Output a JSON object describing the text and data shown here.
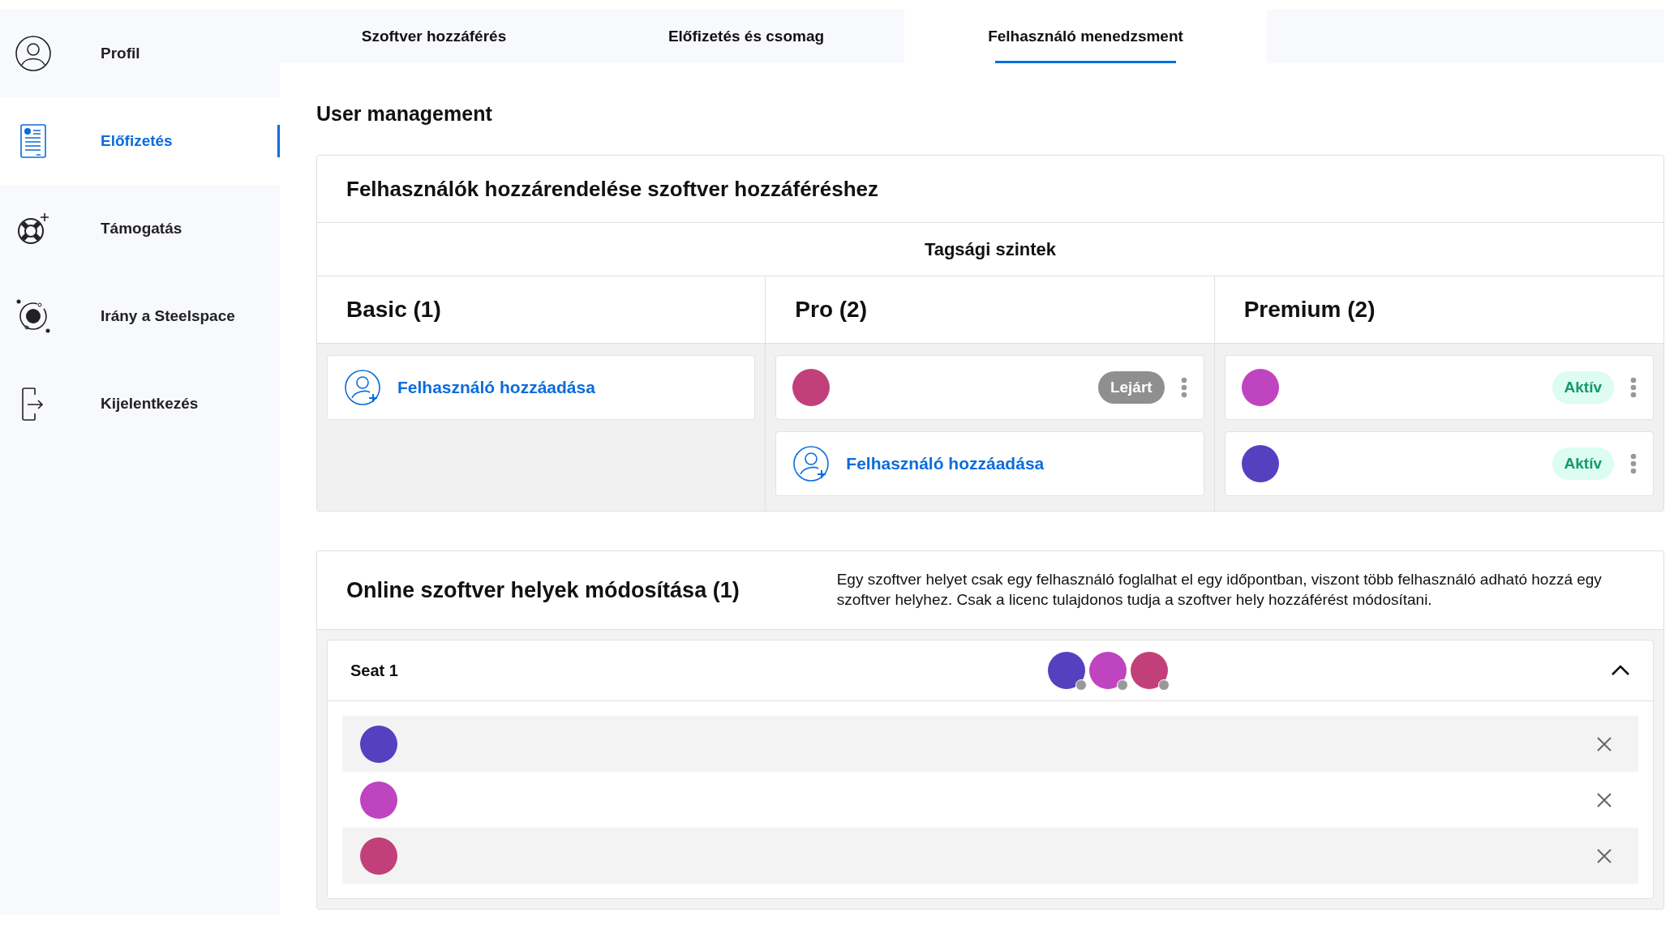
{
  "sidebar": {
    "items": [
      {
        "label": "Profil",
        "kind": "user",
        "selected": false
      },
      {
        "label": "Előfizetés",
        "kind": "document",
        "selected": true
      },
      {
        "label": "Támogatás",
        "kind": "lifebuoy",
        "selected": false
      },
      {
        "label": "Irány a Steelspace",
        "kind": "orbit",
        "selected": false
      },
      {
        "label": "Kijelentkezés",
        "kind": "logout",
        "selected": false
      }
    ]
  },
  "tabs": [
    {
      "label": "Szoftver hozzáférés",
      "selected": false
    },
    {
      "label": "Előfizetés és csomag",
      "selected": false
    },
    {
      "label": "Felhasználó menedzsment",
      "selected": true
    }
  ],
  "page_title": "User management",
  "assignment_card": {
    "title": "Felhasználók hozzárendelése szoftver hozzáféréshez",
    "levels_title": "Tagsági szintek",
    "levels": [
      {
        "title": "Basic (1)",
        "members": [
          {
            "kind": "add",
            "label": "Felhasználó hozzáadása"
          }
        ]
      },
      {
        "title": "Pro (2)",
        "members": [
          {
            "kind": "user",
            "color": "#c2407a",
            "status": {
              "label": "Lejárt",
              "kind": "expired"
            }
          },
          {
            "kind": "add",
            "label": "Felhasználó hozzáadása"
          }
        ]
      },
      {
        "title": "Premium (2)",
        "members": [
          {
            "kind": "user",
            "color": "#bf44c0",
            "status": {
              "label": "Aktív",
              "kind": "active"
            }
          },
          {
            "kind": "user",
            "color": "#5540c0",
            "status": {
              "label": "Aktív",
              "kind": "active"
            }
          }
        ]
      }
    ]
  },
  "seats_card": {
    "title": "Online szoftver helyek módosítása (1)",
    "description": "Egy szoftver helyet csak egy felhasználó foglalhat el egy időpontban, viszont több felhasználó adható hozzá egy szoftver helyhez. Csak a licenc tulajdonos tudja a szoftver hely hozzáférést módosítani.",
    "seats": [
      {
        "label": "Seat 1",
        "expanded": true,
        "users": [
          {
            "color": "#5540c0"
          },
          {
            "color": "#bf44c0"
          },
          {
            "color": "#c2407a"
          }
        ]
      }
    ]
  }
}
